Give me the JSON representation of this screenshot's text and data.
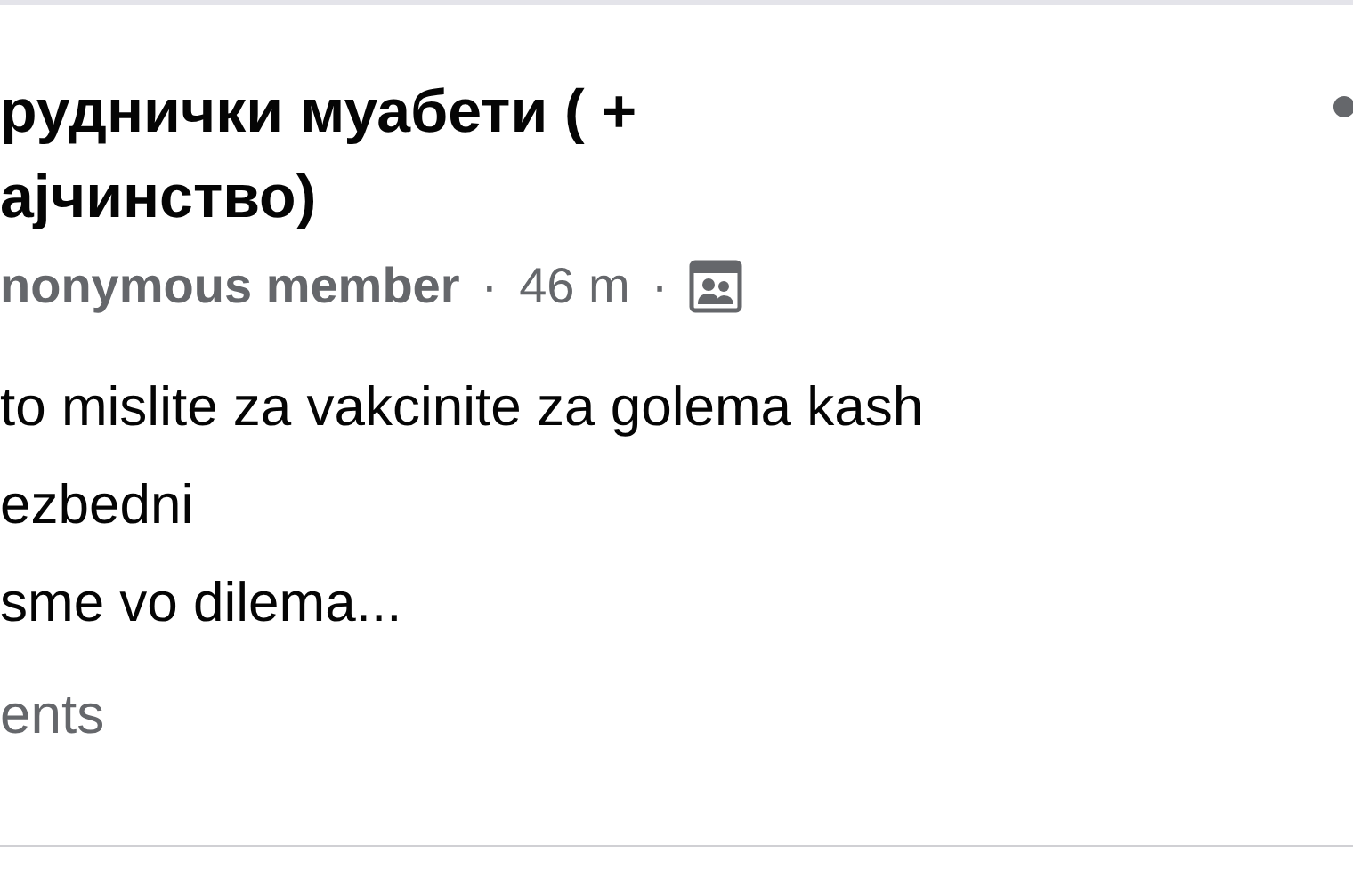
{
  "post": {
    "group_title_lines": [
      "руднички муабети ( +",
      "ајчинство)"
    ],
    "author": "nonymous member",
    "separator_1": "·",
    "time": "46 m",
    "separator_2": "·",
    "body_lines": [
      "to mislite za vakcinite za golema kash",
      "ezbedni",
      "sme vo dilema..."
    ],
    "comments": "ents"
  }
}
